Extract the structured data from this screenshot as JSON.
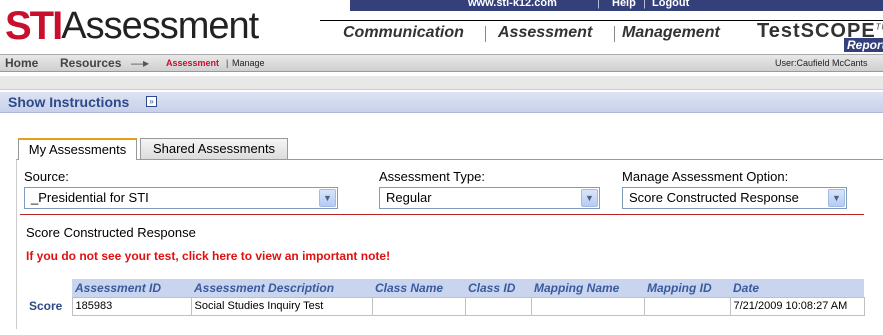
{
  "header": {
    "top_links": [
      "www.sti-k12.com",
      "Help",
      "Logout"
    ],
    "logo_sti": "STI",
    "logo_word": "Assessment",
    "nav": [
      "Communication",
      "Assessment",
      "Management"
    ],
    "testscope": "TestSCOPE",
    "testscope_tm": "TM",
    "testscope_sub": "Reports"
  },
  "breadcrumb": {
    "home": "Home",
    "resources": "Resources",
    "arrow": "—▸",
    "assessment": "Assessment",
    "pipe": "|",
    "manage": "Manage",
    "user": "User:Caufield McCants"
  },
  "instructions": {
    "label": "Show Instructions",
    "icon": "chevron-double-down-icon"
  },
  "tabs": [
    {
      "label": "My Assessments",
      "active": true
    },
    {
      "label": "Shared Assessments",
      "active": false
    }
  ],
  "filters": {
    "source": {
      "label": "Source:",
      "value": "_Presidential for STI"
    },
    "type": {
      "label": "Assessment Type:",
      "value": "Regular"
    },
    "option": {
      "label": "Manage Assessment Option:",
      "value": "Score Constructed Response"
    }
  },
  "section_title": "Score Constructed Response",
  "note_link": "If you do not see your test, click here to view an important note!",
  "table": {
    "headers": [
      "",
      "Assessment ID",
      "Assessment Description",
      "Class Name",
      "Class ID",
      "Mapping Name",
      "Mapping ID",
      "Date"
    ],
    "rows": [
      {
        "action": "Score",
        "assessment_id": "185983",
        "description": "Social Studies Inquiry Test",
        "class_name": "",
        "class_id": "",
        "mapping_name": "",
        "mapping_id": "",
        "date": "7/21/2009 10:08:27 AM"
      }
    ]
  },
  "colors": {
    "brand_red": "#c8102e",
    "nav_blue": "#34407a",
    "header_blue": "#3a5a9e",
    "note_red": "#e01010"
  }
}
